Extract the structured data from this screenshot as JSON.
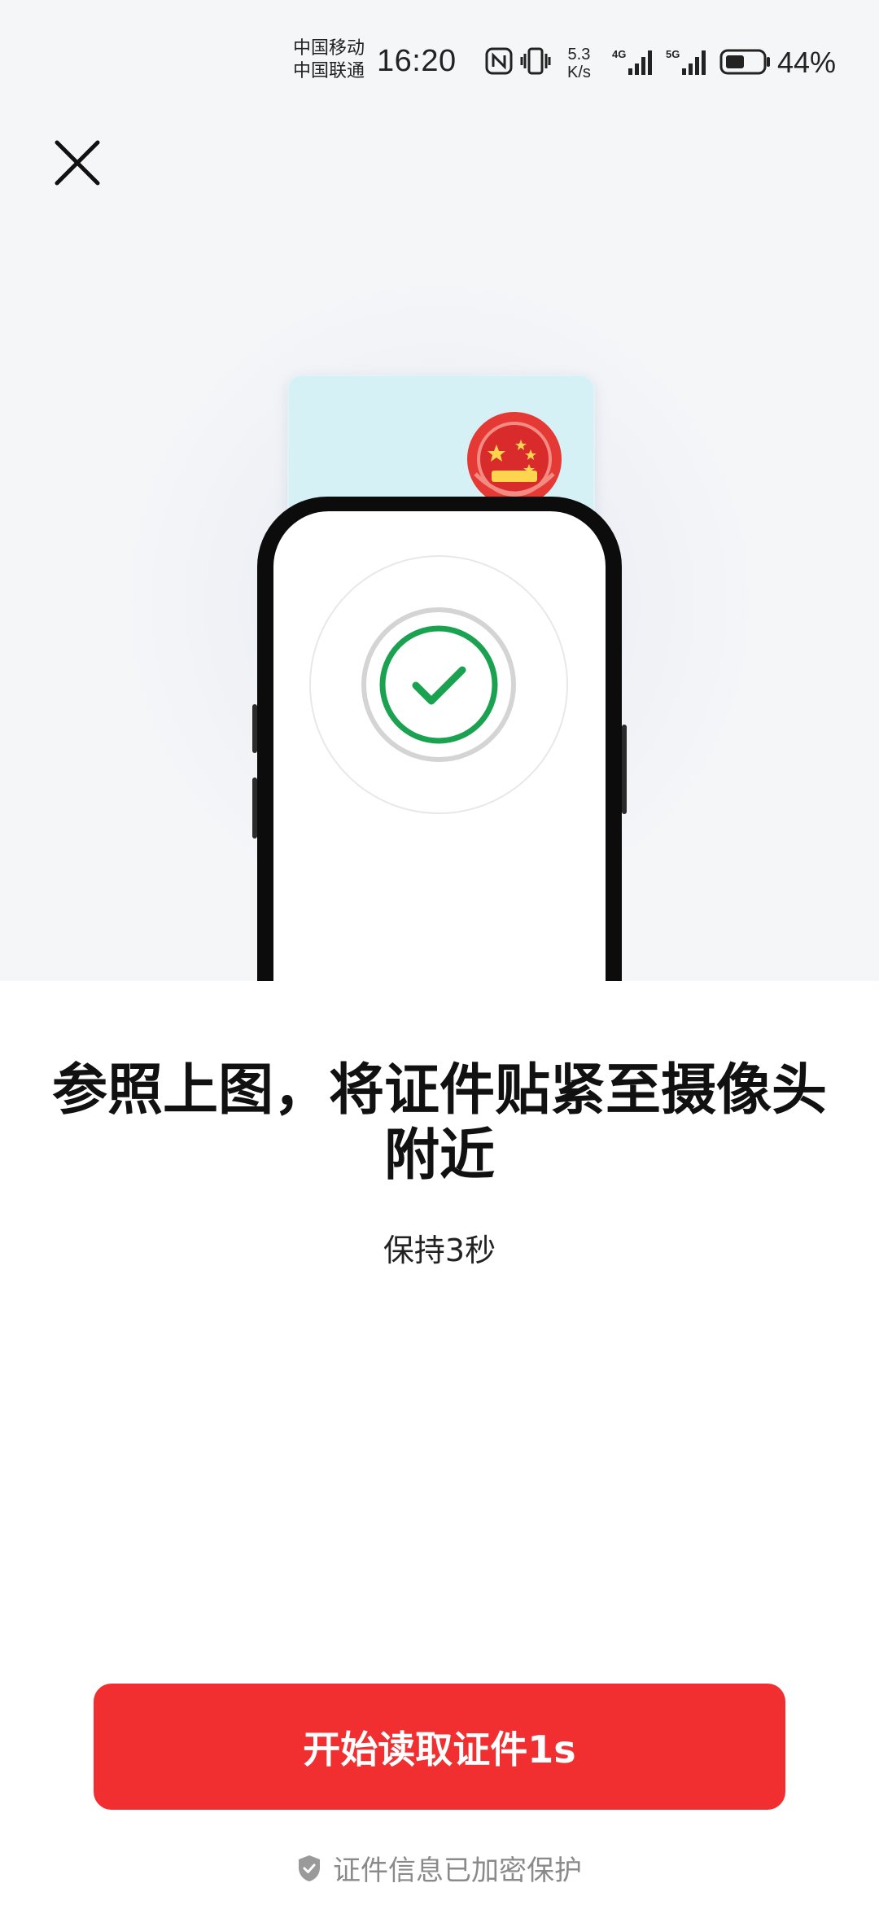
{
  "status_bar": {
    "carrier_1": "中国移动",
    "carrier_2": "中国联通",
    "time": "16:20",
    "speed_value": "5.3",
    "speed_unit": "K/s",
    "network_1": "4G",
    "network_2": "5G",
    "battery_percent": "44%",
    "icons": [
      "nfc-icon",
      "vibrate-icon",
      "signal-4g-icon",
      "signal-5g-icon",
      "battery-icon"
    ]
  },
  "header": {
    "close_icon": "close-icon"
  },
  "illustration": {
    "card_color": "#d6f1f6",
    "emblem_color": "#e53935",
    "check_color": "#1aa251"
  },
  "instruction": {
    "title": "参照上图，将证件贴紧至摄像头附近",
    "subtitle": "保持3秒"
  },
  "action": {
    "button_label": "开始读取证件1s",
    "button_color": "#f22f30"
  },
  "footer": {
    "security_text": "证件信息已加密保护",
    "security_icon": "shield-check-icon"
  }
}
